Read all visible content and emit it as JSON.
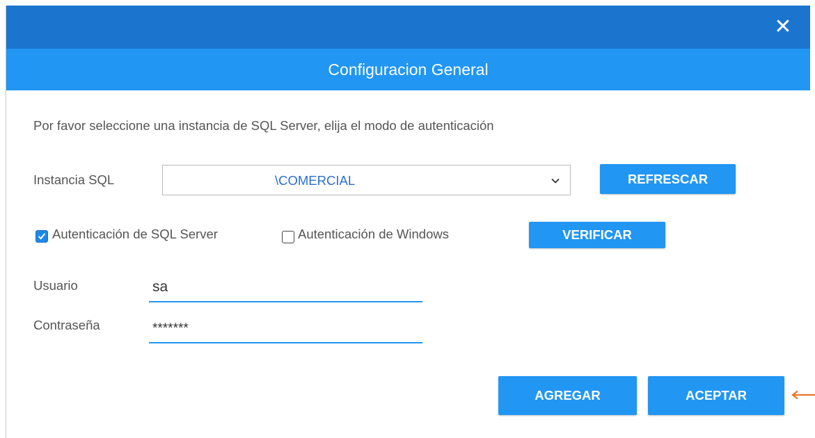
{
  "window": {
    "close_glyph": "✕",
    "title": "Configuracion General"
  },
  "intro_text": "Por favor seleccione una instancia de SQL Server, elija el modo de autenticación",
  "instance": {
    "label": "Instancia SQL",
    "selected_value": "\\COMERCIAL",
    "refresh_button": "REFRESCAR"
  },
  "auth": {
    "sql_server": {
      "label": "Autenticación de SQL Server",
      "checked": true
    },
    "windows": {
      "label": "Autenticación de Windows",
      "checked": false
    },
    "verify_button": "VERIFICAR"
  },
  "user": {
    "label": "Usuario",
    "value": "sa"
  },
  "password": {
    "label": "Contraseña",
    "value": "*******"
  },
  "actions": {
    "add_button": "AGREGAR",
    "accept_button": "ACEPTAR"
  },
  "colors": {
    "titlebar": "#1b75cf",
    "header": "#2196f3",
    "button": "#2196f3",
    "checkbox_checked": "#1e88e5",
    "annotation_arrow": "#e8762c"
  },
  "icons": {
    "close": "close-icon",
    "dropdown": "chevron-down-icon",
    "check": "checkmark-icon",
    "annotation": "arrow-left-icon"
  }
}
